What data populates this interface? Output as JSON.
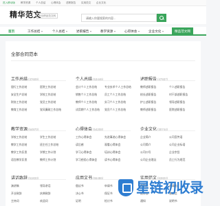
{
  "topbar": {
    "links": [
      "进入移动版",
      "教学资源",
      "个人总结",
      "心得体会",
      "述职报告",
      "实用范文",
      "企业文化"
    ]
  },
  "header": {
    "logo": "精华范文",
    "logo_sub": "专业精品范文网",
    "search_placeholder": "请输入你要搜索的内容..."
  },
  "nav": {
    "items": [
      {
        "label": "首页",
        "caret": false
      },
      {
        "label": "工作总结",
        "caret": true
      },
      {
        "label": "个人总结",
        "caret": true
      },
      {
        "label": "述职报告",
        "caret": true
      },
      {
        "label": "教学资源",
        "caret": true
      },
      {
        "label": "心得体会",
        "caret": true
      },
      {
        "label": "企业文化",
        "caret": true
      },
      {
        "label": "精品范文网",
        "caret": false
      }
    ]
  },
  "main": {
    "title": "全部合同范本",
    "categories": [
      {
        "name": "工作总结",
        "count": "(37609)",
        "links": [
          "银行工作总结",
          "医院工作总结",
          "安全生产总结",
          "学校工作总结",
          "财务工作总结",
          "党员工作总结",
          "教育工作总结",
          "党风廉政工作总结"
        ]
      },
      {
        "name": "个人总结",
        "count": "(53446)",
        "links": [
          "会计个人工作总结",
          "专业技术个人工作总结",
          "销售个人工作总结",
          "员工个人工作总结",
          "教师个人工作总结",
          "实习个人工作总结",
          "试用期个人工作总结",
          "党员个人工作总结"
        ]
      },
      {
        "name": "述职报告",
        "count": "(47937)",
        "links": [
          "教师述职报告",
          "个人述职报告",
          "校长述职报告",
          "村干部述职报告",
          "护士述职报告",
          "领导述职报告",
          "教师述职报告",
          "医院述职报告"
        ]
      },
      {
        "name": "教学资源",
        "count": "(54970)",
        "links": [
          "学校工作总结",
          "学生工作总结",
          "教学工作总结",
          "班主任工作总结",
          "教学工作反思",
          "学期工作计划",
          "语言教学反思",
          "教师工作计划"
        ]
      },
      {
        "name": "心得体会",
        "count": "(54208)",
        "links": [
          "工作心得体会",
          "先进事迹心得体会",
          "读后感",
          "观看心得体会",
          "学习心得体会",
          "培训心得体会",
          "学习经验心得体会",
          "读书心得体会"
        ]
      },
      {
        "name": "企业文化",
        "count": "(30744)",
        "links": [
          "企业简介",
          "公司宣传语",
          "公司简介",
          "公司企业标语",
          "公司口号",
          "企业宗旨",
          "公司企业理念",
          "员工行为规范"
        ]
      },
      {
        "name": "讲话致辞",
        "count": "(51833)",
        "links": [
          "演讲稿",
          "领导讲话",
          "开业致辞",
          "庆典致辞",
          "主持词",
          "欢迎词"
        ]
      },
      {
        "name": "应用文书",
        "count": "(55486)",
        "links": [
          "倡议书",
          "申请书",
          "决心书",
          "保证书",
          "证明",
          "检讨书"
        ]
      },
      {
        "name": "实用范文",
        "count": "(63822)",
        "links": [
          "求职信",
          "邀请函",
          "推荐信",
          "感谢信",
          "通知",
          "说明书"
        ]
      }
    ]
  },
  "watermark": {
    "text": "星链初收录"
  }
}
